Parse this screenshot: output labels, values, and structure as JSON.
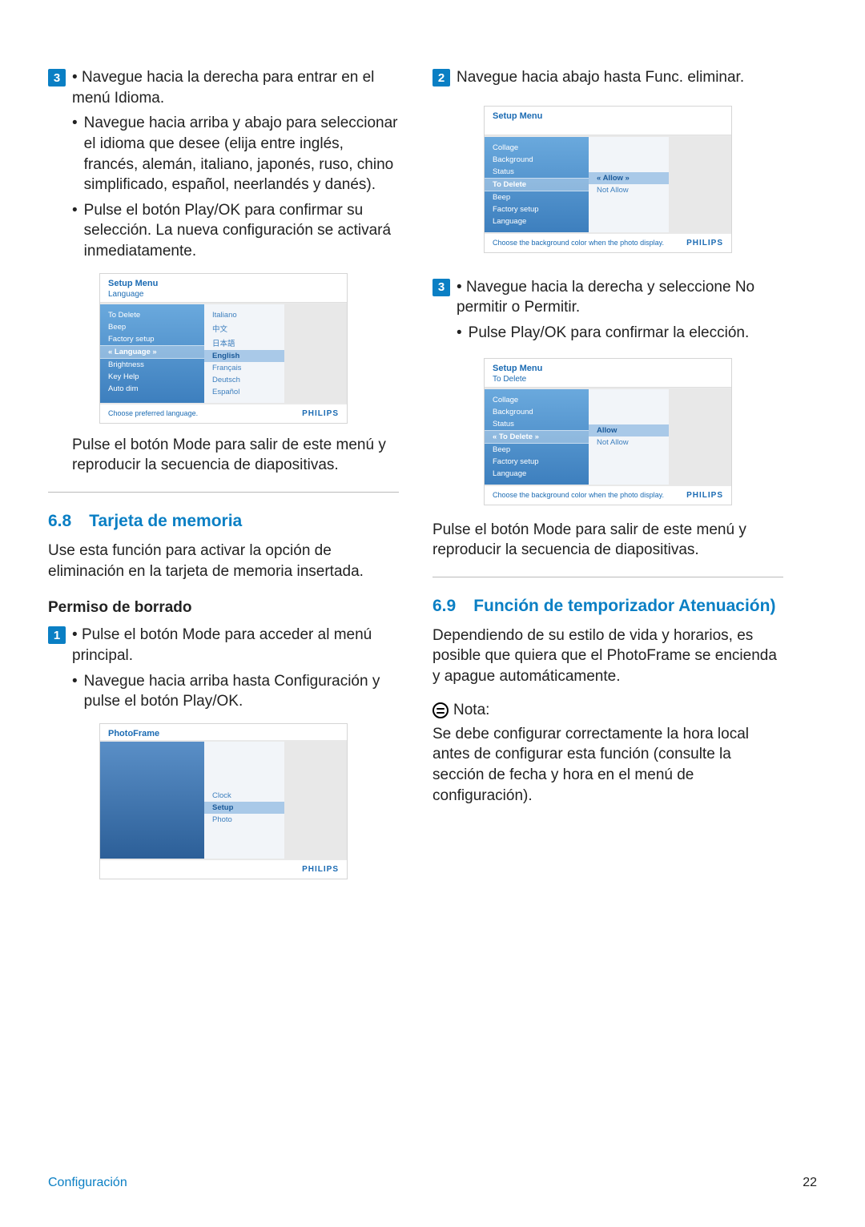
{
  "left": {
    "step3": {
      "t1": "Navegue hacia la derecha para entrar en el menú Idioma.",
      "t2": "Navegue hacia arriba y abajo para seleccionar el idioma que desee (elija entre inglés, francés, alemán, italiano, japonés, ruso, chino simplificado, español, neerlandés y danés).",
      "t3": "Pulse el botón Play/OK para confirmar su selección. La nueva configuración se activará inmediatamente."
    },
    "ss1": {
      "header": "Setup Menu",
      "sub": "Language",
      "left_items": [
        "To Delete",
        "Beep",
        "Factory setup",
        "« Language »",
        "Brightness",
        "Key Help",
        "Auto dim"
      ],
      "left_sel_index": 3,
      "mid_items": [
        "Italiano",
        "中文",
        "日本語",
        "English",
        "Français",
        "Deutsch",
        "Español"
      ],
      "mid_sel_index": 3,
      "footer": "Choose preferred language.",
      "brand": "PHILIPS"
    },
    "after_ss1": "Pulse el botón Mode para salir de este menú y reproducir la secuencia de diapositivas.",
    "sec68_num": "6.8",
    "sec68_title": "Tarjeta de memoria",
    "sec68_body": "Use esta función para activar la opción de eliminación en la tarjeta de memoria insertada.",
    "sub_heading": "Permiso de borrado",
    "step1": {
      "t1": "Pulse el botón Mode para acceder al menú principal.",
      "t2": "Navegue hacia arriba hasta Configuración y pulse el botón Play/OK."
    },
    "ss2": {
      "header": "PhotoFrame",
      "mid_items": [
        "Clock",
        "Setup",
        "Photo"
      ],
      "mid_sel_index": 1,
      "brand": "PHILIPS"
    }
  },
  "right": {
    "step2": {
      "t1": "Navegue hacia abajo hasta Func. eliminar."
    },
    "ss3": {
      "header": "Setup Menu",
      "left_items": [
        "Collage",
        "Background",
        "Status",
        "To Delete",
        "Beep",
        "Factory setup",
        "Language"
      ],
      "left_sel_index": 3,
      "mid_items": [
        "« Allow »",
        "Not Allow"
      ],
      "mid_sel_index": 0,
      "footer": "Choose the background color when the photo display.",
      "brand": "PHILIPS"
    },
    "step3": {
      "t1": "Navegue hacia la derecha y seleccione No permitir o Permitir.",
      "t2": "Pulse Play/OK para confirmar la elección."
    },
    "ss4": {
      "header": "Setup Menu",
      "sub": "To Delete",
      "left_items": [
        "Collage",
        "Background",
        "Status",
        "« To Delete »",
        "Beep",
        "Factory setup",
        "Language"
      ],
      "left_sel_index": 3,
      "mid_items": [
        "Allow",
        "Not Allow"
      ],
      "mid_sel_index": 0,
      "footer": "Choose the background color when the photo display.",
      "brand": "PHILIPS"
    },
    "after_ss4": "Pulse el botón Mode para salir de este menú y reproducir la secuencia de diapositivas.",
    "sec69_num": "6.9",
    "sec69_title": "Función de temporizador Atenuación)",
    "sec69_body": "Dependiendo de su estilo de vida y horarios, es posible que quiera que el PhotoFrame se encienda y apague automáticamente.",
    "note_label": "Nota:",
    "note_body": "Se debe configurar correctamente la hora local antes de configurar esta función (consulte la sección de fecha y hora en el menú de configuración)."
  },
  "footer": {
    "section": "Configuración",
    "page": "22"
  },
  "step_labels": {
    "n1": "1",
    "n2": "2",
    "n3": "3"
  }
}
